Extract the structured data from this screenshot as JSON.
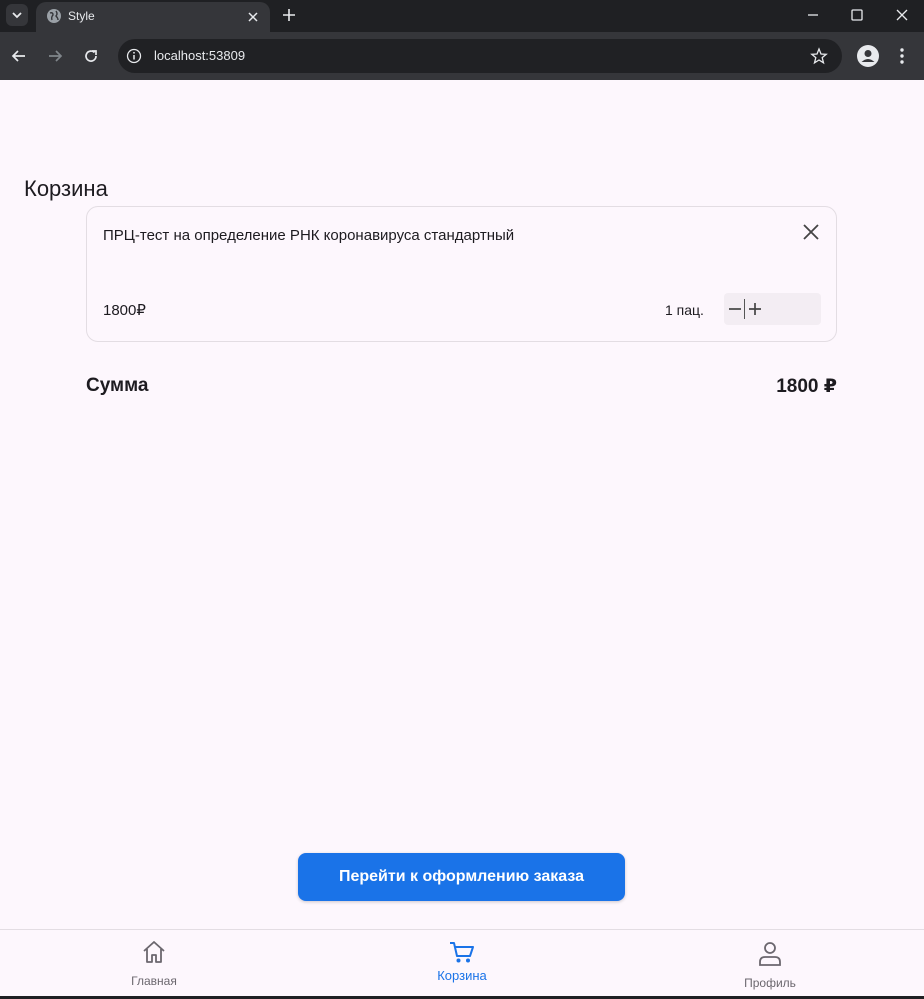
{
  "browser": {
    "tab_title": "Style",
    "url": "localhost:53809"
  },
  "page": {
    "title": "Корзина"
  },
  "cart": {
    "items": [
      {
        "name": "ПРЦ-тест на определение РНК коронавируса стандартный",
        "price": "1800₽",
        "quantity": "1 пац."
      }
    ],
    "sum_label": "Сумма",
    "sum_value": "1800 ₽"
  },
  "checkout_button": "Перейти к оформлению заказа",
  "bottom_nav": {
    "items": [
      {
        "label": "Главная",
        "icon": "home-icon",
        "active": false
      },
      {
        "label": "Корзина",
        "icon": "cart-icon",
        "active": true
      },
      {
        "label": "Профиль",
        "icon": "person-icon",
        "active": false
      }
    ]
  },
  "colors": {
    "accent": "#1a73e8",
    "background": "#fdf7fd",
    "chrome_dark": "#35363a"
  }
}
